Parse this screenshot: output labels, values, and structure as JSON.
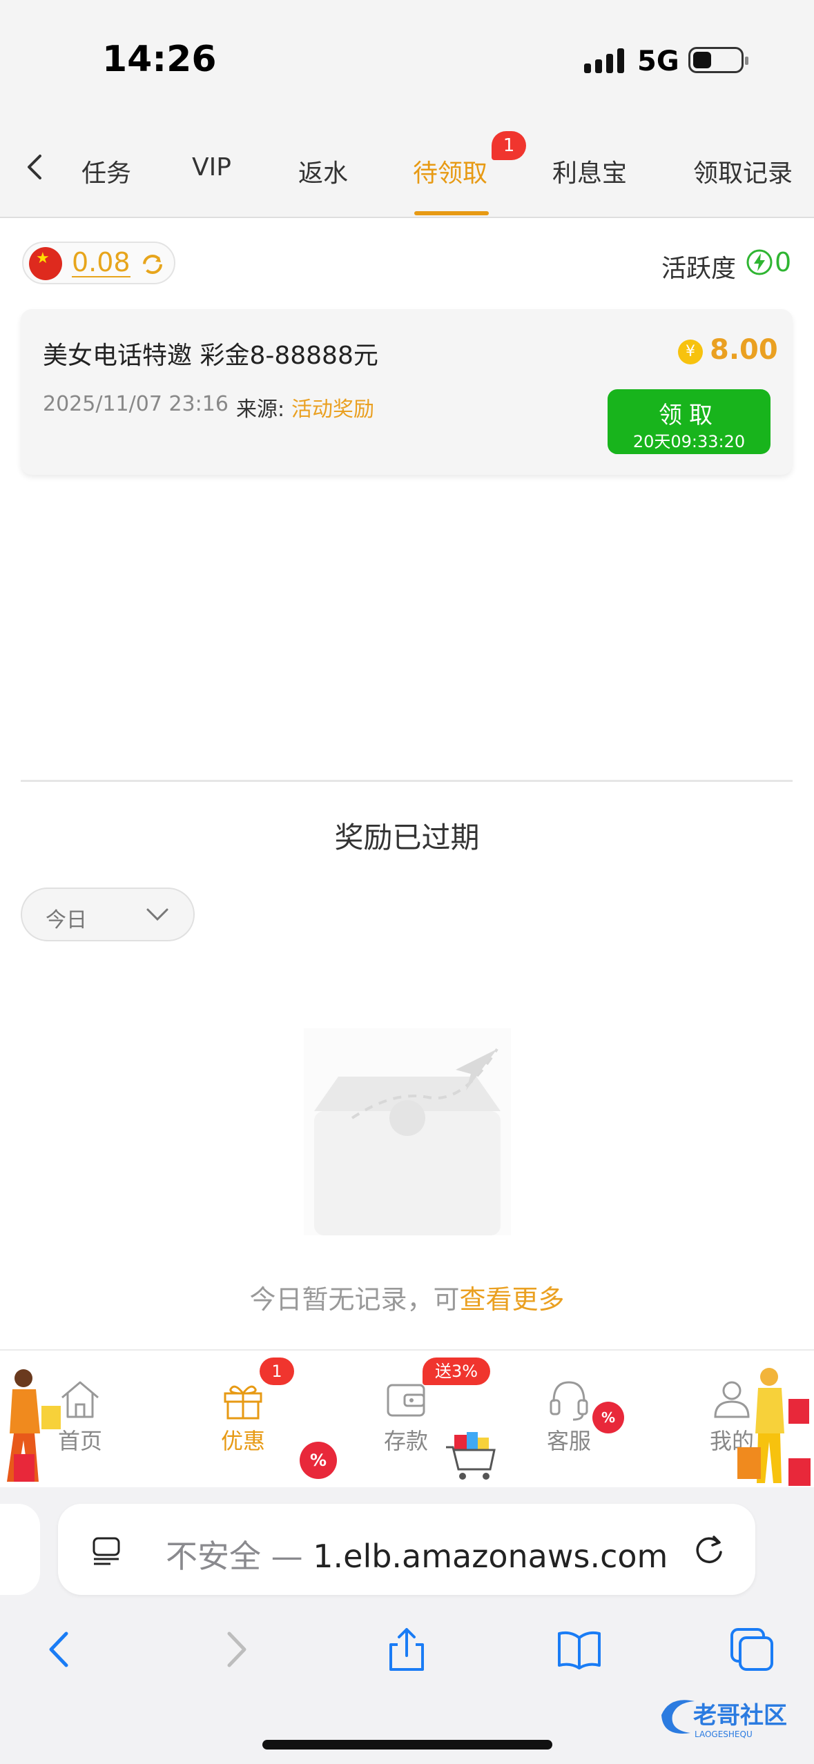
{
  "status_bar": {
    "time": "14:26",
    "network": "5G"
  },
  "tabs": {
    "items": [
      {
        "label": "任务"
      },
      {
        "label": "VIP"
      },
      {
        "label": "返水"
      },
      {
        "label": "待领取"
      },
      {
        "label": "利息宝"
      },
      {
        "label": "领取记录"
      }
    ],
    "active_index": 3,
    "badge": "1"
  },
  "balance": {
    "value": "0.08",
    "activity_label": "活跃度",
    "activity_value": "0"
  },
  "reward_card": {
    "title": "美女电话特邀 彩金8-88888元",
    "coin_symbol": "¥",
    "amount": "8.00",
    "date": "2025/11/07 23:16",
    "source_label": "来源:",
    "source": "活动奖励",
    "claim_label": "领取",
    "claim_timer": "20天09:33:20"
  },
  "expired": {
    "title": "奖励已过期",
    "date_filter": "今日",
    "empty_text": "今日暂无记录，可",
    "empty_link": "查看更多"
  },
  "bottom_nav": {
    "items": [
      {
        "label": "首页"
      },
      {
        "label": "优惠"
      },
      {
        "label": "存款"
      },
      {
        "label": "客服"
      },
      {
        "label": "我的"
      }
    ],
    "active_index": 1,
    "promo_badge": "1",
    "deposit_badge": "送3%",
    "pct_symbol": "%"
  },
  "browser": {
    "url_prefix": "不安全 — ",
    "url": "1.elb.amazonaws.com"
  },
  "watermark": {
    "text": "老哥社区",
    "subtext": "LAOGESHEQU"
  },
  "colors": {
    "accent": "#e79a14",
    "green": "#18b41c",
    "badge": "#f0352e"
  }
}
